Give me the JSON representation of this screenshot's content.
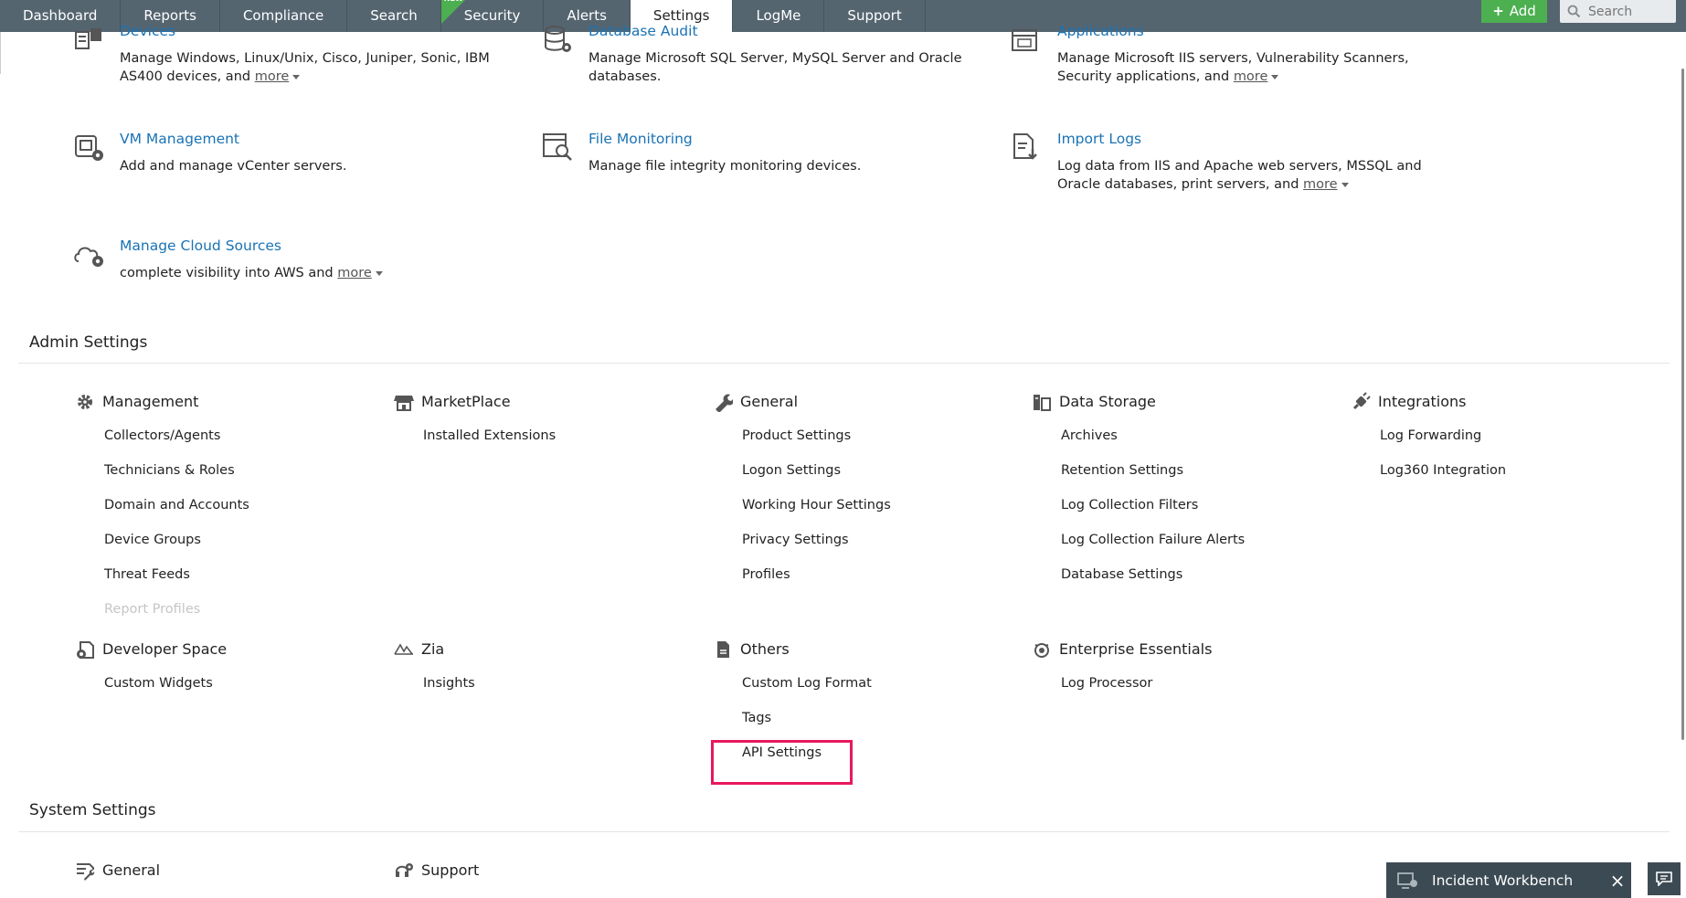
{
  "nav": {
    "tabs": [
      {
        "label": "Dashboard",
        "active": false
      },
      {
        "label": "Reports",
        "active": false
      },
      {
        "label": "Compliance",
        "active": false
      },
      {
        "label": "Search",
        "active": false
      },
      {
        "label": "Security",
        "active": false,
        "badge": "NEW"
      },
      {
        "label": "Alerts",
        "active": false
      },
      {
        "label": "Settings",
        "active": true
      },
      {
        "label": "LogMe",
        "active": false
      },
      {
        "label": "Support",
        "active": false
      }
    ],
    "add_label": "Add",
    "search_placeholder": "Search"
  },
  "log_sources": [
    {
      "title": "Devices",
      "desc": "Manage Windows, Linux/Unix, Cisco, Juniper, Sonic, IBM AS400 devices, and",
      "more": "more",
      "icon": "devices-icon"
    },
    {
      "title": "Database Audit",
      "desc": "Manage Microsoft SQL Server, MySQL Server and Oracle databases.",
      "icon": "database-audit-icon"
    },
    {
      "title": "Applications",
      "desc": "Manage Microsoft IIS servers, Vulnerability Scanners, Security applications, and",
      "more": "more",
      "icon": "applications-icon"
    },
    {
      "title": "VM Management",
      "desc": "Add and manage vCenter servers.",
      "icon": "vm-management-icon"
    },
    {
      "title": "File Monitoring",
      "desc": "Manage file integrity monitoring devices.",
      "icon": "file-monitoring-icon"
    },
    {
      "title": "Import Logs",
      "desc": "Log data from IIS and Apache web servers, MSSQL and Oracle databases, print servers, and",
      "more": "more",
      "icon": "import-logs-icon"
    },
    {
      "title": "Manage Cloud Sources",
      "desc": "complete visibility into AWS and",
      "more": "more",
      "icon": "cloud-sources-icon"
    }
  ],
  "admin_settings": {
    "title": "Admin Settings",
    "groups": [
      {
        "title": "Management",
        "icon": "gear-icon",
        "items": [
          "Collectors/Agents",
          "Technicians & Roles",
          "Domain and Accounts",
          "Device Groups",
          "Threat Feeds",
          "Report Profiles"
        ],
        "disabled_items": [
          "Report Profiles"
        ]
      },
      {
        "title": "MarketPlace",
        "icon": "store-icon",
        "items": [
          "Installed Extensions"
        ]
      },
      {
        "title": "General",
        "icon": "wrench-icon",
        "items": [
          "Product Settings",
          "Logon Settings",
          "Working Hour Settings",
          "Privacy Settings",
          "Profiles"
        ]
      },
      {
        "title": "Data Storage",
        "icon": "storage-icon",
        "items": [
          "Archives",
          "Retention Settings",
          "Log Collection Filters",
          "Log Collection Failure Alerts",
          "Database Settings"
        ]
      },
      {
        "title": "Integrations",
        "icon": "plug-icon",
        "items": [
          "Log Forwarding",
          "Log360 Integration"
        ]
      },
      {
        "title": "Developer Space",
        "icon": "developer-icon",
        "items": [
          "Custom Widgets"
        ]
      },
      {
        "title": "Zia",
        "icon": "zia-icon",
        "items": [
          "Insights"
        ]
      },
      {
        "title": "Others",
        "icon": "document-icon",
        "items": [
          "Custom Log Format",
          "Tags",
          "API Settings"
        ]
      },
      {
        "title": "Enterprise Essentials",
        "icon": "enterprise-icon",
        "items": [
          "Log Processor"
        ]
      }
    ]
  },
  "system_settings": {
    "title": "System Settings",
    "groups": [
      {
        "title": "General",
        "icon": "system-general-icon"
      },
      {
        "title": "Support",
        "icon": "support-icon"
      }
    ]
  },
  "workbench": {
    "label": "Incident Workbench"
  },
  "colors": {
    "nav_bg": "#556570",
    "link": "#1a73b5",
    "add_button": "#4caf50",
    "highlight": "#e8185c",
    "workbench_bg": "#3c4a53"
  }
}
